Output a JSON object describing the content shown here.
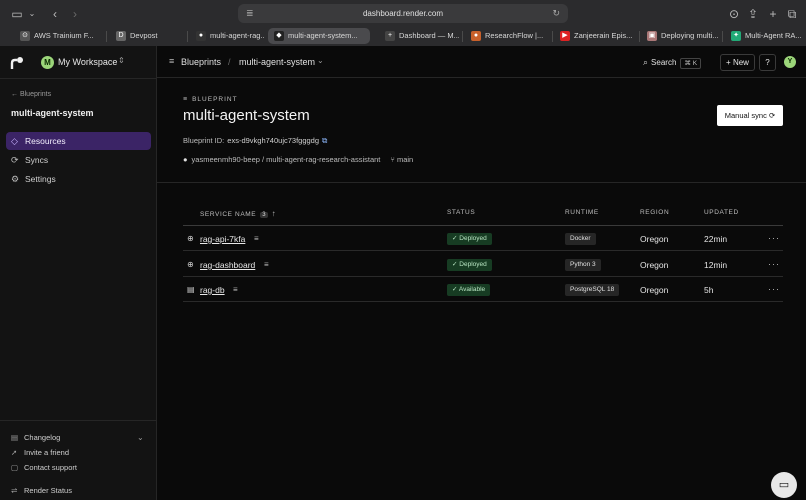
{
  "browser": {
    "url": "dashboard.render.com",
    "tabs": [
      {
        "label": "AWS Trainium F..."
      },
      {
        "label": "Devpost"
      },
      {
        "label": "multi-agent-rag..."
      },
      {
        "label": "multi-agent-system..."
      },
      {
        "label": "Dashboard — M..."
      },
      {
        "label": "ResearchFlow |..."
      },
      {
        "label": "Zanjeerain Epis..."
      },
      {
        "label": "Deploying multi..."
      },
      {
        "label": "Multi-Agent RA..."
      }
    ]
  },
  "sidebar": {
    "workspace_initial": "M",
    "workspace_name": "My Workspace",
    "back_label": "Blueprints",
    "title": "multi-agent-system",
    "nav": [
      {
        "label": "Resources"
      },
      {
        "label": "Syncs"
      },
      {
        "label": "Settings"
      }
    ],
    "footer": [
      {
        "label": "Changelog"
      },
      {
        "label": "Invite a friend"
      },
      {
        "label": "Contact support"
      },
      {
        "label": "Render Status"
      }
    ]
  },
  "topbar": {
    "crumb_root": "Blueprints",
    "crumb_current": "multi-agent-system",
    "search_label": "Search",
    "search_kbd": "⌘ K",
    "new_label": "New",
    "help_label": "?",
    "user_initial": "Y"
  },
  "blueprint": {
    "label": "BLUEPRINT",
    "title": "multi-agent-system",
    "sync_label": "Manual sync",
    "id_label": "Blueprint ID:",
    "id_value": "exs-d9vkgh740ujc73fgggdg",
    "repo": "yasmeenmh90-beep / multi-agent-rag-research-assistant",
    "branch": "main"
  },
  "table": {
    "headers": {
      "name": "SERVICE NAME",
      "count": "3",
      "status": "STATUS",
      "runtime": "RUNTIME",
      "region": "REGION",
      "updated": "UPDATED"
    },
    "rows": [
      {
        "name": "rag-api-7kfa",
        "status": "Deployed",
        "runtime": "Docker",
        "region": "Oregon",
        "updated": "22min",
        "icon": "globe-icon"
      },
      {
        "name": "rag-dashboard",
        "status": "Deployed",
        "runtime": "Python 3",
        "region": "Oregon",
        "updated": "12min",
        "icon": "globe-icon"
      },
      {
        "name": "rag-db",
        "status": "Available",
        "runtime": "PostgreSQL 18",
        "region": "Oregon",
        "updated": "5h",
        "icon": "database-icon"
      }
    ]
  },
  "colors": {
    "accent_nav": "#3b2466",
    "status_bg": "#173c23",
    "status_text": "#b9e6c3",
    "avatar": "#9cd67a"
  }
}
